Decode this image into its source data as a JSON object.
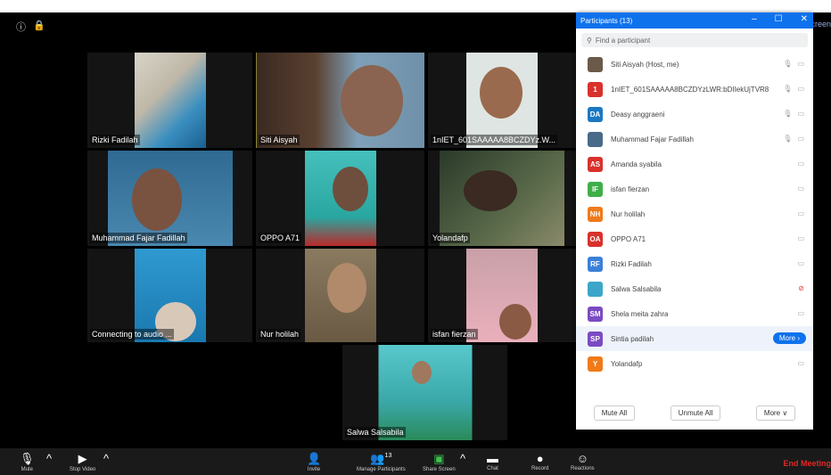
{
  "tiles": [
    {
      "name": "Rizki Fadilah",
      "bg": "#3a6e8f"
    },
    {
      "name": "Siti Aisyah",
      "bg": "#5a4a3e"
    },
    {
      "name": "1nIET_601SAAAAA8BCZDYz.W...",
      "bg": "#dfe5e2"
    },
    {
      "name": "Muhammad Fajar Fadillah",
      "bg": "#3d78a0"
    },
    {
      "name": "OPPO A71",
      "bg": "#3cb5b0"
    },
    {
      "name": "Yolandafp",
      "bg": "#3a4a3a"
    },
    {
      "name": "Connecting to audio ...",
      "bg": "#2e8dbf"
    },
    {
      "name": "Nur holilah",
      "bg": "#7a6a55"
    },
    {
      "name": "isfan fierzan",
      "bg": "#e9a9b4"
    },
    {
      "name": "Salwa Salsabila",
      "bg": "#4fc3c9"
    }
  ],
  "status": {
    "screen_label": "Screen"
  },
  "panel": {
    "title": "Participants (13)",
    "minimize": "–",
    "maximize": "☐",
    "close": "✕",
    "search_placeholder": "Find a participant",
    "participants": [
      {
        "initials": "",
        "name": "Siti Aisyah (Host, me)",
        "color": "#6b5a4a",
        "mic": "🎙",
        "cam": "▭"
      },
      {
        "initials": "1",
        "name": "1nIET_601SAAAAA8BCZDYzLWR:bDIIekUjTVR8",
        "color": "#d9312c",
        "mic": "🎙",
        "cam": "▭"
      },
      {
        "initials": "DA",
        "name": "Deasy anggraeni",
        "color": "#1a78c2",
        "mic": "🎙",
        "cam": "▭"
      },
      {
        "initials": "",
        "name": "Muhammad Fajar Fadillah",
        "color": "#4a6a8a",
        "mic": "🎙",
        "cam": "▭"
      },
      {
        "initials": "AS",
        "name": "Amanda syabila",
        "color": "#d9312c",
        "mic": "",
        "cam": "▭"
      },
      {
        "initials": "IF",
        "name": "isfan fierzan",
        "color": "#3fae49",
        "mic": "",
        "cam": "▭"
      },
      {
        "initials": "NH",
        "name": "Nur holilah",
        "color": "#f07a1a",
        "mic": "",
        "cam": "▭"
      },
      {
        "initials": "OA",
        "name": "OPPO A71",
        "color": "#d9312c",
        "mic": "",
        "cam": "▭"
      },
      {
        "initials": "RF",
        "name": "Rizki Fadilah",
        "color": "#3a7fd9",
        "mic": "",
        "cam": "▭"
      },
      {
        "initials": "",
        "name": "Salwa Salsabila",
        "color": "#3ba6c9",
        "mic": "",
        "cam": "⊘"
      },
      {
        "initials": "SM",
        "name": "Shela meita zahra",
        "color": "#7a4bc2",
        "mic": "",
        "cam": "▭"
      },
      {
        "initials": "SP",
        "name": "Sintia padilah",
        "color": "#7a4bc2",
        "mic": "",
        "cam": ""
      },
      {
        "initials": "Y",
        "name": "Yolandafp",
        "color": "#f07a1a",
        "mic": "",
        "cam": "▭"
      }
    ],
    "more_label": "More ›",
    "mute_all": "Mute All",
    "unmute_all": "Unmute All",
    "more_menu": "More ∨"
  },
  "toolbar": {
    "mute": "Mute",
    "stop_video": "Stop Video",
    "invite": "Invite",
    "manage_participants": "Manage Participants",
    "participant_count": "13",
    "share_screen": "Share Screen",
    "chat": "Chat",
    "record": "Record",
    "reactions": "Reactions",
    "end": "End Meeting"
  }
}
